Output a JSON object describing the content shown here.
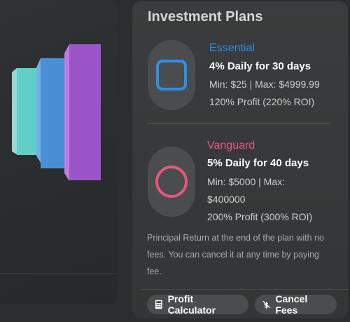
{
  "plans_card": {
    "title": "Investment Plans",
    "plans": [
      {
        "name": "Essential",
        "headline": "4% Daily for 30 days",
        "limits": "Min: $25 | Max: $4999.99",
        "profit": "120% Profit (220% ROI)",
        "icon": "square-icon",
        "color": "#2e8fe8"
      },
      {
        "name": "Vanguard",
        "headline": "5% Daily for 40 days",
        "limits": "Min: $5000 | Max: $400000",
        "profit": "200% Profit (300% ROI)",
        "icon": "circle-icon",
        "color": "#e6577d"
      }
    ],
    "note": "Principal Return at the end of the plan with no fees. You can cancel it at any time by paying fee.",
    "buttons": {
      "calculator": "Profit Calculator",
      "cancel_fees": "Cancel Fees"
    }
  }
}
